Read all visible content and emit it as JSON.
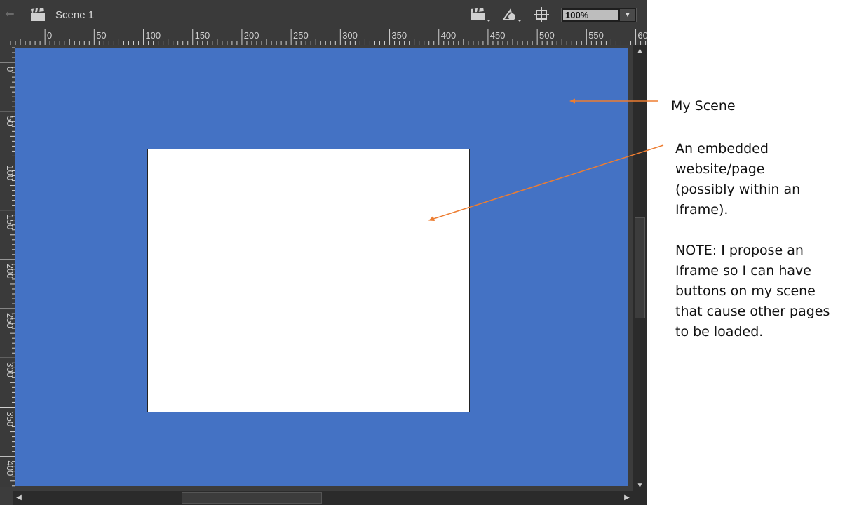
{
  "header": {
    "scene_name": "Scene 1",
    "zoom_value": "100%",
    "icons": [
      "back-arrow-icon",
      "clapperboard-icon",
      "edit-scene-icon",
      "edit-symbol-icon",
      "center-stage-icon",
      "dropdown-icon"
    ]
  },
  "rulers": {
    "horizontal_labels": [
      "0",
      "50",
      "100",
      "150",
      "200",
      "250",
      "300",
      "350",
      "400",
      "450",
      "500",
      "550",
      "60"
    ],
    "vertical_labels": [
      "0",
      "50",
      "100",
      "150",
      "200",
      "250",
      "300",
      "350",
      "400"
    ]
  },
  "stage": {
    "background_color": "#4472c4",
    "frame_color": "#ffffff"
  },
  "annotations": {
    "scene_label": "My Scene",
    "embed_lines": [
      "An embedded",
      "website/page",
      "(possibly within an",
      "Iframe)."
    ],
    "note_lines": [
      "NOTE: I propose an",
      "Iframe so I can have",
      "buttons on my scene",
      "that cause other pages",
      "to be loaded."
    ],
    "arrow_color": "#ed7d31"
  }
}
